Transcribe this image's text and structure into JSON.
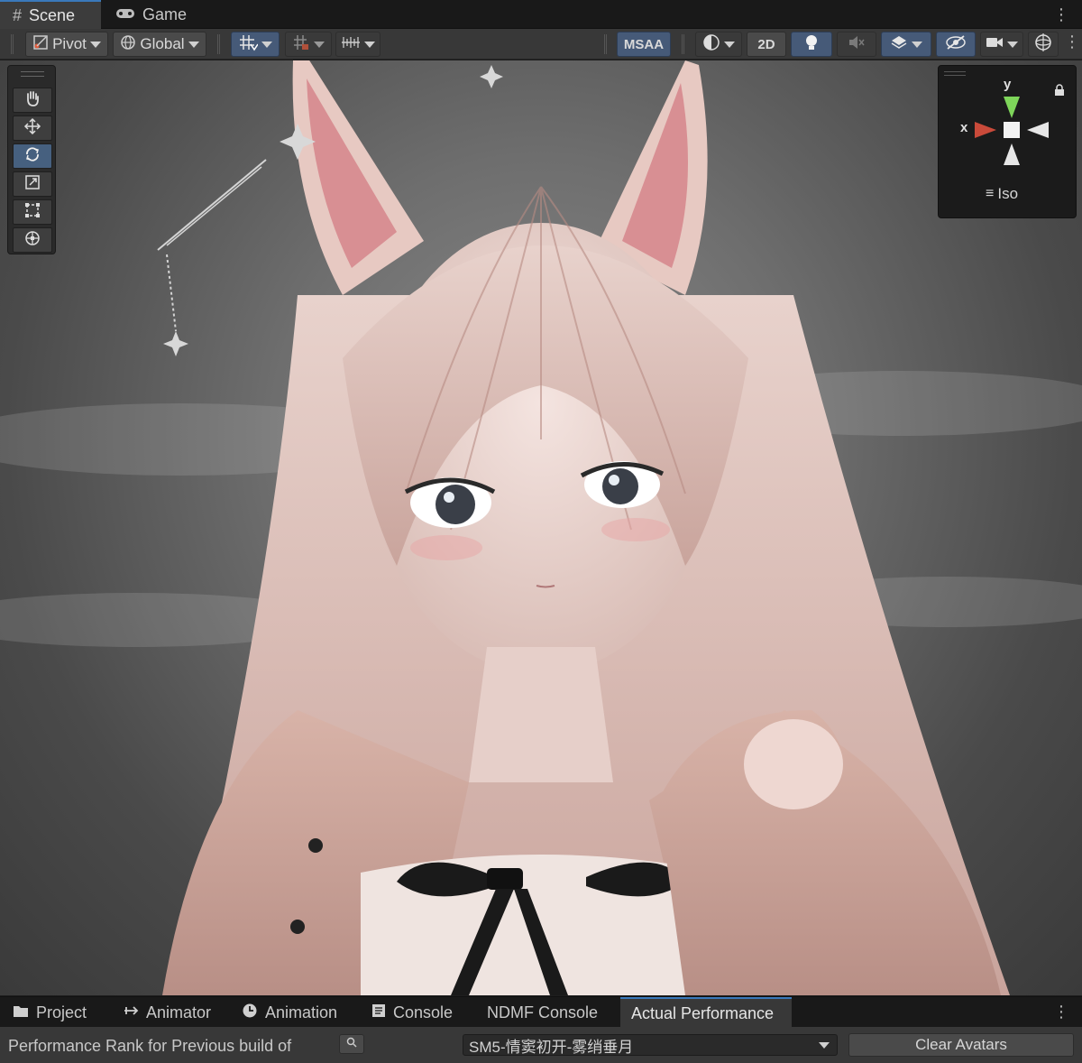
{
  "window": {
    "tabs": [
      {
        "label": "Scene",
        "icon": "hash-icon",
        "active": true
      },
      {
        "label": "Game",
        "icon": "gamepad-icon",
        "active": false
      }
    ]
  },
  "toolbar": {
    "pivot_label": "Pivot",
    "global_label": "Global",
    "msaa_label": "MSAA",
    "twod_label": "2D"
  },
  "gizmo": {
    "x_label": "x",
    "y_label": "y",
    "view_label": "Iso",
    "colors": {
      "x": "#c94a3a",
      "y": "#7ed55a"
    }
  },
  "bottom_tabs": [
    {
      "label": "Project",
      "icon": "folder-icon"
    },
    {
      "label": "Animator",
      "icon": "animator-icon"
    },
    {
      "label": "Animation",
      "icon": "clock-icon"
    },
    {
      "label": "Console",
      "icon": "console-icon"
    },
    {
      "label": "NDMF Console",
      "icon": ""
    },
    {
      "label": "Actual Performance",
      "icon": "",
      "active": true
    }
  ],
  "performance": {
    "label": "Performance Rank for Previous build of",
    "selected_avatar": "SM5-情窦初开-雾绡垂月",
    "clear_button": "Clear Avatars"
  }
}
